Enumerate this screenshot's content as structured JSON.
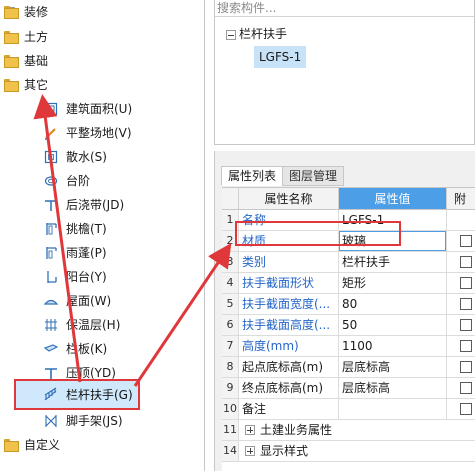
{
  "tree": {
    "top": [
      {
        "label": "装修",
        "state": "collapsed"
      },
      {
        "label": "土方",
        "state": "collapsed"
      },
      {
        "label": "基础",
        "state": "collapsed"
      },
      {
        "label": "其它",
        "state": "expanded"
      }
    ],
    "children": [
      {
        "label": "建筑面积(U)",
        "icon": "floor-area-icon"
      },
      {
        "label": "平整场地(V)",
        "icon": "site-leveling-icon"
      },
      {
        "label": "散水(S)",
        "icon": "apron-icon"
      },
      {
        "label": "台阶",
        "icon": "steps-icon"
      },
      {
        "label": "后浇带(JD)",
        "icon": "post-cast-strip-icon"
      },
      {
        "label": "挑檐(T)",
        "icon": "eave-icon"
      },
      {
        "label": "雨蓬(P)",
        "icon": "canopy-icon"
      },
      {
        "label": "阳台(Y)",
        "icon": "balcony-icon"
      },
      {
        "label": "屋面(W)",
        "icon": "roof-icon"
      },
      {
        "label": "保温层(H)",
        "icon": "insulation-icon"
      },
      {
        "label": "栏板(K)",
        "icon": "parapet-icon"
      },
      {
        "label": "压顶(YD)",
        "icon": "coping-icon"
      },
      {
        "label": "栏杆扶手(G)",
        "icon": "railing-icon",
        "selected": true
      },
      {
        "label": "脚手架(JS)",
        "icon": "scaffold-icon"
      }
    ],
    "bottom": [
      {
        "label": "自定义",
        "state": "collapsed"
      }
    ]
  },
  "components": {
    "search_placeholder": "搜索构件...",
    "parent": "栏杆扶手",
    "child": "LGFS-1"
  },
  "properties": {
    "tabs": [
      {
        "label": "属性列表",
        "active": true
      },
      {
        "label": "图层管理",
        "active": false
      }
    ],
    "headers": {
      "name": "属性名称",
      "value": "属性值",
      "extra": "附加"
    },
    "rows": [
      {
        "num": "1",
        "name": "名称",
        "value": "LGFS-1",
        "blue": true,
        "checkbox": false
      },
      {
        "num": "2",
        "name": "材质",
        "value": "玻璃",
        "blue": true,
        "checkbox": true
      },
      {
        "num": "3",
        "name": "类别",
        "value": "栏杆扶手",
        "blue": true,
        "checkbox": true
      },
      {
        "num": "4",
        "name": "扶手截面形状",
        "value": "矩形",
        "blue": true,
        "checkbox": true
      },
      {
        "num": "5",
        "name": "扶手截面宽度(...",
        "value": "80",
        "blue": true,
        "checkbox": true
      },
      {
        "num": "6",
        "name": "扶手截面高度(...",
        "value": "50",
        "blue": true,
        "checkbox": true
      },
      {
        "num": "7",
        "name": "高度(mm)",
        "value": "1100",
        "blue": true,
        "checkbox": true
      },
      {
        "num": "8",
        "name": "起点底标高(m)",
        "value": "层底标高",
        "blue": false,
        "checkbox": true
      },
      {
        "num": "9",
        "name": "终点底标高(m)",
        "value": "层底标高",
        "blue": false,
        "checkbox": true
      },
      {
        "num": "10",
        "name": "备注",
        "value": "",
        "blue": false,
        "checkbox": true
      }
    ],
    "groups": [
      {
        "num": "11",
        "label": "土建业务属性"
      },
      {
        "num": "14",
        "label": "显示样式"
      }
    ]
  },
  "colors": {
    "highlight": "#e0383a",
    "header_accent": "#4c9ee6",
    "link_blue": "#2466c8"
  }
}
